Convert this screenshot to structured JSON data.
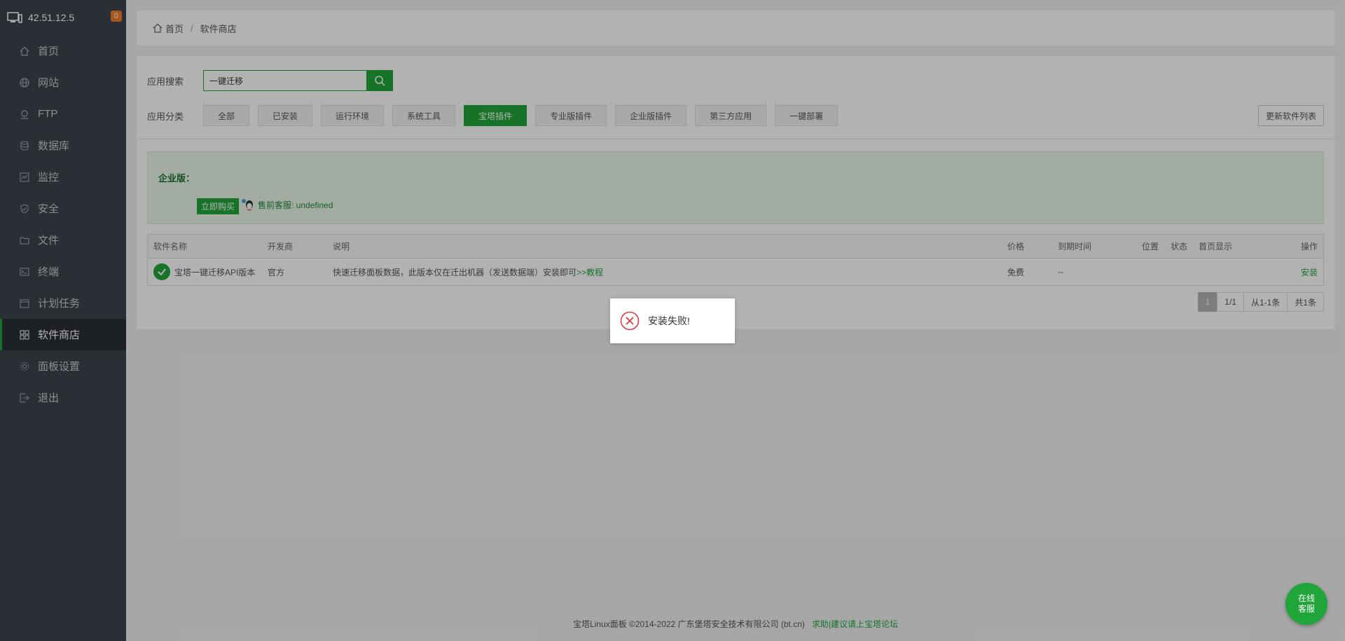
{
  "sidebar": {
    "ip": "42.51.12.5",
    "badge": "0",
    "items": [
      {
        "label": "首页",
        "icon": "home-icon"
      },
      {
        "label": "网站",
        "icon": "globe-icon"
      },
      {
        "label": "FTP",
        "icon": "ftp-icon"
      },
      {
        "label": "数据库",
        "icon": "database-icon"
      },
      {
        "label": "监控",
        "icon": "monitor-icon"
      },
      {
        "label": "安全",
        "icon": "shield-icon"
      },
      {
        "label": "文件",
        "icon": "folder-icon"
      },
      {
        "label": "终端",
        "icon": "terminal-icon"
      },
      {
        "label": "计划任务",
        "icon": "calendar-icon"
      },
      {
        "label": "软件商店",
        "icon": "apps-icon",
        "active": true
      },
      {
        "label": "面板设置",
        "icon": "gear-icon"
      },
      {
        "label": "退出",
        "icon": "logout-icon"
      }
    ]
  },
  "breadcrumb": {
    "home": "首页",
    "sep": "/",
    "current": "软件商店"
  },
  "search": {
    "label": "应用搜索",
    "value": "一键迁移"
  },
  "categories": {
    "label": "应用分类",
    "items": [
      "全部",
      "已安装",
      "运行环境",
      "系统工具",
      "宝塔插件",
      "专业版插件",
      "企业版插件",
      "第三方应用",
      "一键部署"
    ],
    "active_index": 4,
    "refresh": "更新软件列表"
  },
  "promo": {
    "title": "企业版：",
    "buy": "立即购买",
    "contact": "售前客服: undefined"
  },
  "table": {
    "headers": [
      "软件名称",
      "开发商",
      "说明",
      "价格",
      "到期时间",
      "位置",
      "状态",
      "首页显示",
      "操作"
    ],
    "rows": [
      {
        "name": "宝塔一键迁移API版本",
        "dev": "官方",
        "desc": "快速迁移面板数据，此版本仅在迁出机器（发送数据端）安装即可",
        "desc_link": ">>教程",
        "price": "免费",
        "expire": "--",
        "action": "安装"
      }
    ]
  },
  "pager": {
    "current": "1",
    "pages": "1/1",
    "range": "从1-1条",
    "total": "共1条"
  },
  "toast": {
    "message": "安装失败!"
  },
  "footer": {
    "copyright": "宝塔Linux面板 ©2014-2022 广东堡塔安全技术有限公司 (bt.cn)",
    "link": "求助|建议请上宝塔论坛"
  },
  "chat": {
    "line1": "在线",
    "line2": "客服"
  },
  "colors": {
    "accent": "#20a53a",
    "sidebar": "#3c444d",
    "badge": "#f07b2a",
    "error": "#e0393e"
  }
}
